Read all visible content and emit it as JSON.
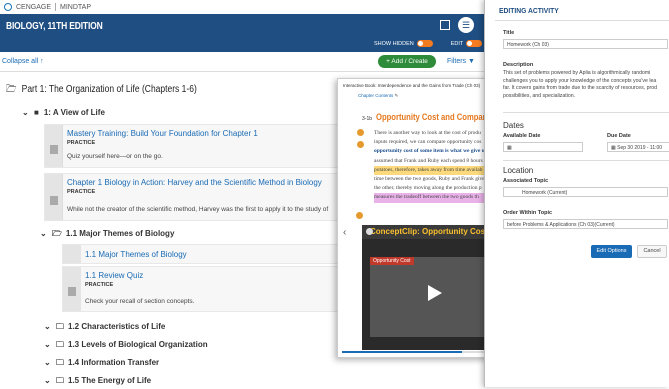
{
  "topbar": {
    "brand": "CENGAGE",
    "product": "MINDTAP"
  },
  "header": {
    "title": "BIOLOGY, 11TH EDITION",
    "show_hidden_label": "SHOW HIDDEN",
    "edit_label": "EDIT"
  },
  "toolbar": {
    "collapse_all": "Collapse all",
    "add_create": "+ Add / Create",
    "filters": "Filters"
  },
  "outline": {
    "part_title": "Part 1: The Organization of Life (Chapters 1-6)",
    "chapter1": "1: A View of Life",
    "items": [
      {
        "title": "Mastery Training: Build Your Foundation for Chapter 1",
        "type": "PRACTICE",
        "desc": "Quiz yourself here—or on the go."
      },
      {
        "title": "Chapter 1 Biology in Action: Harvey and the Scientific Method in Biology",
        "type": "PRACTICE",
        "desc": "While not the creator of the scientific method, Harvey was the first to apply it to the study of"
      }
    ],
    "section_1_1": "1.1 Major Themes of Biology",
    "sub_items": [
      {
        "title": "1.1 Major Themes of Biology"
      },
      {
        "title": "1.1 Review Quiz",
        "type": "PRACTICE",
        "desc": "Check your recall of section concepts."
      }
    ],
    "sections": [
      "1.2 Characteristics of Life",
      "1.3 Levels of Biological Organization",
      "1.4 Information Transfer",
      "1.5 The Energy of Life"
    ]
  },
  "ebook": {
    "source": "Interactive Book: Interdependence and the Gains from Trade (Ch 03)",
    "chapter_contents": "Chapter Contents",
    "section_num": "3-1b",
    "section_title": "Opportunity Cost and Comparative Ad",
    "lines": [
      "There is another way to look at the cost of produ",
      "inputs required, we can compare opportunity cos",
      "opportunity cost of some item is what we give u",
      "assumed that Frank and Ruby each spend 8 hours",
      "potatoes, therefore, takes away from time availab",
      "time between the two goods, Ruby and Frank give",
      "the other, thereby moving along the production p",
      "measures the tradeoff between the two goods th"
    ],
    "video_title": "ConceptClip: Opportunity Cost",
    "video_caption": "Opportunity Cost"
  },
  "edit_panel": {
    "heading": "EDITING ACTIVITY",
    "title_label": "Title",
    "title_value": "Homework (Ch 03)",
    "description_label": "Description",
    "description_lines": [
      "This set of problems powered by Aplia is algorithmically randomi",
      "challenges you to apply your knowledge of the concepts you've lea",
      "far. It covers gains from trade due to the scarcity of resources, prod",
      "possibilities, and specialization."
    ],
    "dates_heading": "Dates",
    "available_date_label": "Available Date",
    "due_date_label": "Due Date",
    "due_date_value": "Sep 30 2019 - 11:00",
    "location_heading": "Location",
    "associated_topic_label": "Associated Topic",
    "associated_topic_value": "Homework (Current)",
    "order_label": "Order Within Topic",
    "order_value": "before Problems & Applications (Ch 03)(Current)",
    "save_button": "Edit Options",
    "cancel_button": "Cancel"
  }
}
